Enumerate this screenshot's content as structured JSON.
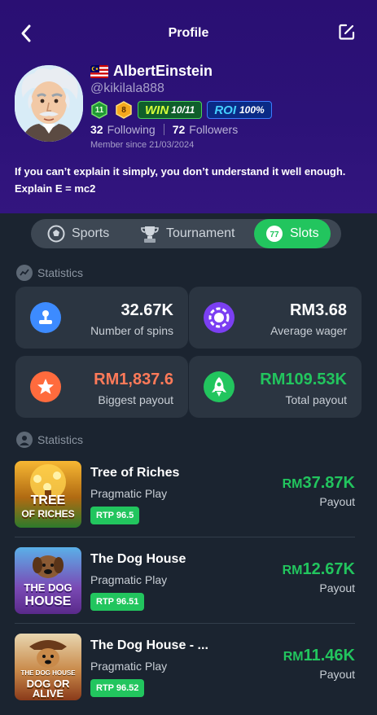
{
  "header": {
    "title": "Profile",
    "back_icon": "chevron-left-icon",
    "edit_icon": "edit-icon"
  },
  "profile": {
    "username": "AlbertEinstein",
    "handle": "@kikilala888",
    "level_badge": "11",
    "rank_badge": "8",
    "win_label": "WIN",
    "win_value": "10/11",
    "roi_label": "ROI",
    "roi_value": "100%",
    "following_count": "32",
    "following_label": "Following",
    "followers_count": "72",
    "followers_label": "Followers",
    "member_since": "Member since 21/03/2024",
    "bio_line1": "If you can’t explain it simply, you don’t understand it well enough.",
    "bio_line2": "Explain E = mc2"
  },
  "tabs": [
    {
      "label": "Sports",
      "icon": "soccer-ball-icon"
    },
    {
      "label": "Tournament",
      "icon": "trophy-icon"
    },
    {
      "label": "Slots",
      "icon": "slot-777-icon",
      "active": true
    }
  ],
  "stats_title": "Statistics",
  "stats": [
    {
      "value": "32.67K",
      "label": "Number of spins",
      "color": "#ffffff"
    },
    {
      "value": "RM3.68",
      "label": "Average wager",
      "color": "#ffffff"
    },
    {
      "value": "RM1,837.6",
      "label": "Biggest payout",
      "color": "#ff7a59"
    },
    {
      "value": "RM109.53K",
      "label": "Total payout",
      "color": "#22c55e"
    }
  ],
  "games_title": "Statistics",
  "games": [
    {
      "name": "Tree of Riches",
      "provider": "Pragmatic Play",
      "rtp": "RTP 96.5",
      "currency": "RM",
      "payout": "37.87K",
      "payout_label": "Payout",
      "thumb_text_1": "TREE",
      "thumb_text_2": "OF RICHES"
    },
    {
      "name": "The Dog House",
      "provider": "Pragmatic Play",
      "rtp": "RTP 96.51",
      "currency": "RM",
      "payout": "12.67K",
      "payout_label": "Payout",
      "thumb_text_1": "THE DOG",
      "thumb_text_2": "HOUSE"
    },
    {
      "name": "The Dog House - ...",
      "provider": "Pragmatic Play",
      "rtp": "RTP 96.52",
      "currency": "RM",
      "payout": "11.46K",
      "payout_label": "Payout",
      "thumb_text_1": "THE DOG HOUSE",
      "thumb_text_2": "DOG OR ALIVE"
    }
  ],
  "colors": {
    "accent": "#22c55e",
    "header_bg": "#2c1278",
    "page_bg": "#1b2430",
    "card_bg": "#2b3541"
  }
}
